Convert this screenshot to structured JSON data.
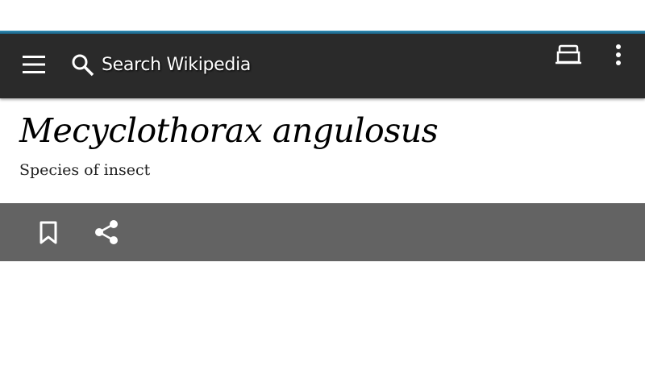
{
  "header": {
    "search_placeholder": "Search Wikipedia",
    "accent_color": "#2f8fb8",
    "toolbar_color": "#2a2a2a"
  },
  "article": {
    "title": "Mecyclothorax angulosus",
    "description": "Species of insect"
  },
  "actions": {
    "bar_color": "#636363",
    "icons": [
      "bookmark-icon",
      "share-icon"
    ]
  }
}
